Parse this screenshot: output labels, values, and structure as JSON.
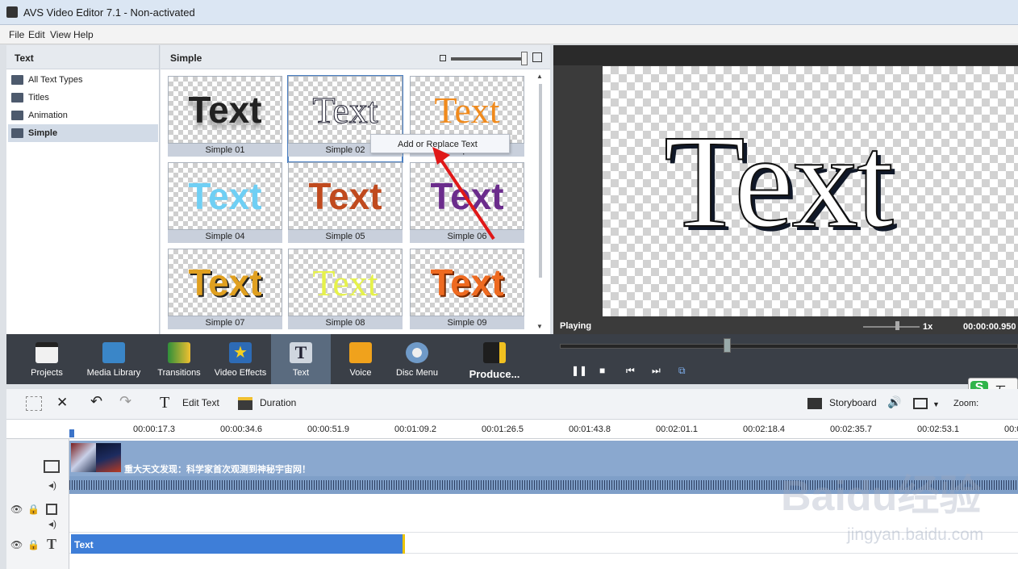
{
  "window": {
    "title": "AVS Video Editor 7.1 - Non-activated"
  },
  "menu": [
    "File",
    "Edit",
    "View",
    "Help"
  ],
  "category_panel": {
    "header": "Text",
    "items": [
      {
        "label": "All Text Types",
        "selected": false
      },
      {
        "label": "Titles",
        "selected": false
      },
      {
        "label": "Animation",
        "selected": false
      },
      {
        "label": "Simple",
        "selected": true
      }
    ]
  },
  "grid_panel": {
    "header": "Simple",
    "thumbnails": [
      {
        "label": "Simple 01",
        "sample": "Text",
        "color": "#222222"
      },
      {
        "label": "Simple 02",
        "sample": "Text",
        "color": "#ffffff",
        "selected": true
      },
      {
        "label": "Simple 03",
        "sample": "Text",
        "color": "#f08a1c"
      },
      {
        "label": "Simple 04",
        "sample": "Text",
        "color": "#6fcff4"
      },
      {
        "label": "Simple 05",
        "sample": "Text",
        "color": "#c04a1e"
      },
      {
        "label": "Simple 06",
        "sample": "Text",
        "color": "#6b2c8c"
      },
      {
        "label": "Simple 07",
        "sample": "Text",
        "color": "#e0a020"
      },
      {
        "label": "Simple 08",
        "sample": "Text",
        "color": "#e6f24a"
      },
      {
        "label": "Simple 09",
        "sample": "Text",
        "color": "#ee6a20"
      }
    ],
    "context_menu": "Add or Replace Text"
  },
  "preview": {
    "text": "Text",
    "status": "Playing",
    "speed": "1x",
    "time": "00:00:00.950"
  },
  "toolbar": [
    {
      "label": "Projects",
      "icon": "clapper-icon"
    },
    {
      "label": "Media Library",
      "icon": "film-icon"
    },
    {
      "label": "Transitions",
      "icon": "transitions-icon"
    },
    {
      "label": "Video Effects",
      "icon": "star-icon"
    },
    {
      "label": "Text",
      "icon": "text-icon",
      "selected": true
    },
    {
      "label": "Voice",
      "icon": "microphone-icon"
    },
    {
      "label": "Disc Menu",
      "icon": "disc-icon"
    },
    {
      "label": "Produce...",
      "icon": "produce-icon"
    }
  ],
  "transport": [
    "❚❚",
    "■",
    "⏮",
    "⏭",
    "⧉"
  ],
  "timeline_toolbar": {
    "edit_text": "Edit Text",
    "duration": "Duration",
    "storyboard": "Storyboard",
    "zoom": "Zoom:"
  },
  "ruler": [
    "00:00:17.3",
    "00:00:34.6",
    "00:00:51.9",
    "00:01:09.2",
    "00:01:26.5",
    "00:01:43.8",
    "00:02:01.1",
    "00:02:18.4",
    "00:02:35.7",
    "00:02:53.1",
    "00:0"
  ],
  "tracks": {
    "video_title": "重大天文发现：科学家首次观测到神秘宇宙网！",
    "text_clip": "Text"
  },
  "watermark": {
    "logo": "Baidu经验",
    "url": "jingyan.baidu.com"
  },
  "ime": {
    "s": "S",
    "char": "五"
  }
}
